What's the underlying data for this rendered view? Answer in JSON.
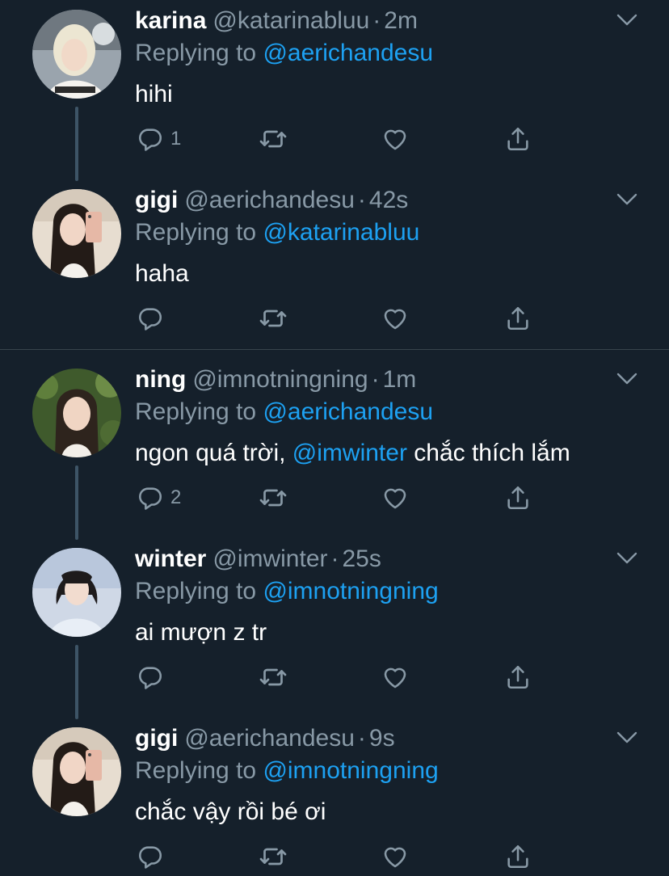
{
  "tweets": [
    {
      "name": "karina",
      "handle": "@katarinabluu",
      "time": "2m",
      "replying_label": "Replying to",
      "replying_to": "@aerichandesu",
      "text": "hihi",
      "reply_count": "1"
    },
    {
      "name": "gigi",
      "handle": "@aerichandesu",
      "time": "42s",
      "replying_label": "Replying to",
      "replying_to": "@katarinabluu",
      "text": "haha",
      "reply_count": ""
    },
    {
      "name": "ning",
      "handle": "@imnotningning",
      "time": "1m",
      "replying_label": "Replying to",
      "replying_to": "@aerichandesu",
      "text_before": "ngon quá trời, ",
      "text_mention": "@imwinter",
      "text_after": " chắc thích lắm",
      "reply_count": "2"
    },
    {
      "name": "winter",
      "handle": "@imwinter",
      "time": "25s",
      "replying_label": "Replying to",
      "replying_to": "@imnotningning",
      "text": "ai mượn z tr",
      "reply_count": ""
    },
    {
      "name": "gigi",
      "handle": "@aerichandesu",
      "time": "9s",
      "replying_label": "Replying to",
      "replying_to": "@imnotningning",
      "text": "chắc vậy rồi bé ơi",
      "reply_count": ""
    }
  ],
  "separator": "·",
  "colors": {
    "background": "#15202b",
    "secondary_text": "#8899a6",
    "accent": "#1da1f2",
    "divider": "#38444d"
  },
  "icons": [
    "reply-icon",
    "retweet-icon",
    "like-icon",
    "share-icon",
    "chevron-down-icon"
  ]
}
